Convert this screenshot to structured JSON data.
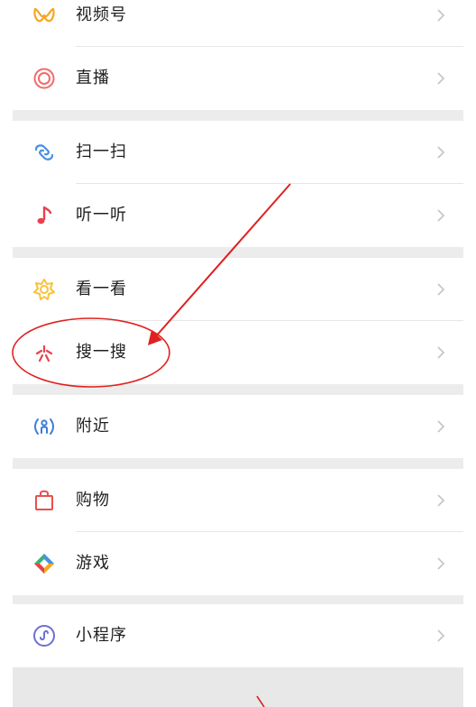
{
  "menu": {
    "items": [
      {
        "label": "视频号",
        "icon": "channels-icon"
      },
      {
        "label": "直播",
        "icon": "live-icon"
      },
      {
        "label": "扫一扫",
        "icon": "scan-icon"
      },
      {
        "label": "听一听",
        "icon": "music-note-icon"
      },
      {
        "label": "看一看",
        "icon": "top-stories-icon"
      },
      {
        "label": "搜一搜",
        "icon": "search-sparkle-icon"
      },
      {
        "label": "附近",
        "icon": "nearby-icon"
      },
      {
        "label": "购物",
        "icon": "shopping-bag-icon"
      },
      {
        "label": "游戏",
        "icon": "games-icon"
      },
      {
        "label": "小程序",
        "icon": "mini-programs-icon"
      }
    ]
  },
  "colors": {
    "background": "#ffffff",
    "section_gap": "#ececec",
    "annotation_red": "#e02020",
    "channels_orange": "#f5a623",
    "live_red": "#f26a6a",
    "scan_blue": "#4a90e2",
    "music_red": "#e8414d",
    "top_stories_yellow": "#f7c23b",
    "nearby_blue": "#3c7dd8",
    "shopping_red": "#e55050",
    "mini_program_purple": "#6b6fd6"
  },
  "annotation": {
    "highlighted_item": "搜一搜",
    "shapes": [
      "ellipse",
      "arrow"
    ]
  }
}
